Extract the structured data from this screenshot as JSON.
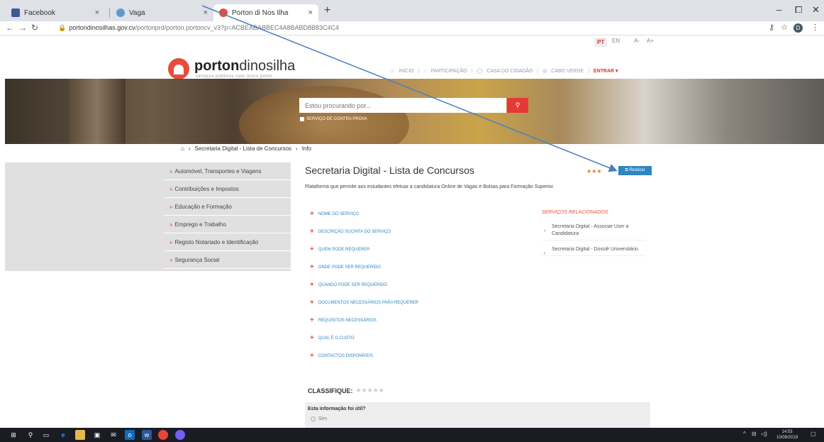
{
  "browser": {
    "tabs": [
      {
        "title": "Facebook",
        "close": "×"
      },
      {
        "title": "Vaga",
        "close": "×"
      },
      {
        "title": "Porton di Nos Ilha",
        "close": "×"
      }
    ],
    "new_tab": "+",
    "url_host": "portondinosilhas.gov.cv",
    "url_path": "/portonprd/porton.portoncv_v3?p=ACBEABABBEC4A8BABD8B83C4C4",
    "profile_initial": "D",
    "window_controls": {
      "minimize": "–",
      "maximize": "⧠",
      "close": "✕"
    }
  },
  "header": {
    "lang_pt": "PT",
    "lang_en": "EN",
    "font_smaller": "A-",
    "font_larger": "A+",
    "logo_bold": "porton",
    "logo_rest": "dinosilha",
    "logo_tagline": "serviços públicos num único ponto",
    "nav": {
      "inicio": "INÍCIO",
      "participacao": "PARTICIPAÇÃO",
      "casa": "CASA DO CIDADÃO",
      "cabo": "CABO VERDE",
      "entrar": "ENTRAR"
    }
  },
  "search": {
    "placeholder": "Estou procurando por...",
    "contra_prova": "SERVIÇO DE CONTRA PROVA"
  },
  "breadcrumb": {
    "item1": "Secretaria Digital - Lista de Concursos",
    "item2": "Info"
  },
  "sidebar": {
    "items": [
      "Automóvel, Transportes e Viagens",
      "Contribuições e Impostos",
      "Educação e Formação",
      "Emprego e Trabalho",
      "Registo Notariado e Identificação",
      "Segurança Social"
    ]
  },
  "main": {
    "title": "Secretaria Digital - Lista de Concursos",
    "stars": "★★★",
    "realizar": "Realizar",
    "description": "Plataforma que permite aos estudantes efetuar a candidatura Online de Vagas e Bolsas para Formação Superior.",
    "sections": [
      "NOME DO SERVIÇO",
      "DESCRIÇÃO SUCINTA DO SERVIÇO",
      "QUEM PODE REQUERER",
      "ONDE PODE SER REQUERIDO",
      "QUANDO PODE SER REQUERIDO",
      "DOCUMENTOS NECESSÁRIOS PARA REQUERER",
      "REQUISITOS NECESSÁRIOS",
      "QUAL É O CUSTO",
      "CONTACTOS DISPONÍVEIS"
    ],
    "related_heading": "SERVIÇOS RELACIONADOS",
    "related": [
      "Secretaria Digital - Associar User a Candidatura",
      "Secretaria Digital - Dossiê Universitário"
    ],
    "classifique": "CLASSIFIQUE:",
    "classifique_stars": "★★★★★",
    "feedback_question": "Esta informação foi útil?",
    "feedback_yes": "Sim"
  },
  "taskbar": {
    "time": "14:53",
    "date": "10/09/2019"
  },
  "colors": {
    "accent_red": "#e74c3c",
    "link_blue": "#2e86c1",
    "sidebar_gray": "#e0e0e0"
  }
}
